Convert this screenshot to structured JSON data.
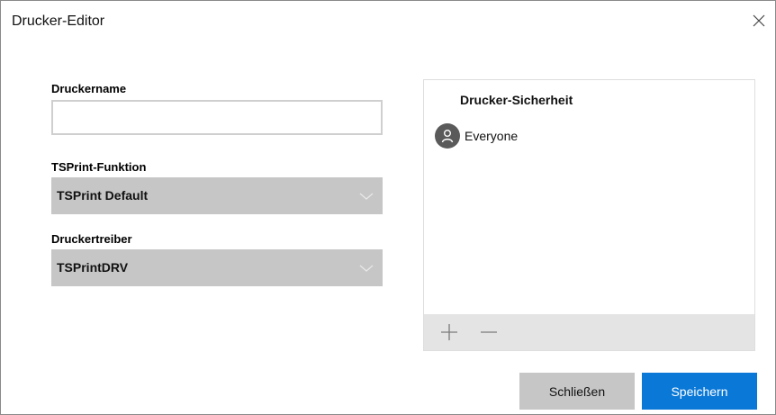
{
  "window": {
    "title": "Drucker-Editor"
  },
  "form": {
    "printer_name_label": "Druckername",
    "printer_name_value": "",
    "function_label": "TSPrint-Funktion",
    "function_value": "TSPrint Default",
    "driver_label": "Druckertreiber",
    "driver_value": "TSPrintDRV"
  },
  "security": {
    "title": "Drucker-Sicherheit",
    "users": [
      {
        "label": "Everyone",
        "icon": "user-icon"
      }
    ],
    "add_icon": "plus-icon",
    "remove_icon": "minus-icon"
  },
  "buttons": {
    "close_label": "Schließen",
    "save_label": "Speichern"
  },
  "colors": {
    "accent": "#0a78d7",
    "select_bg": "#c6c6c6",
    "toolbar_bg": "#e4e4e4"
  }
}
